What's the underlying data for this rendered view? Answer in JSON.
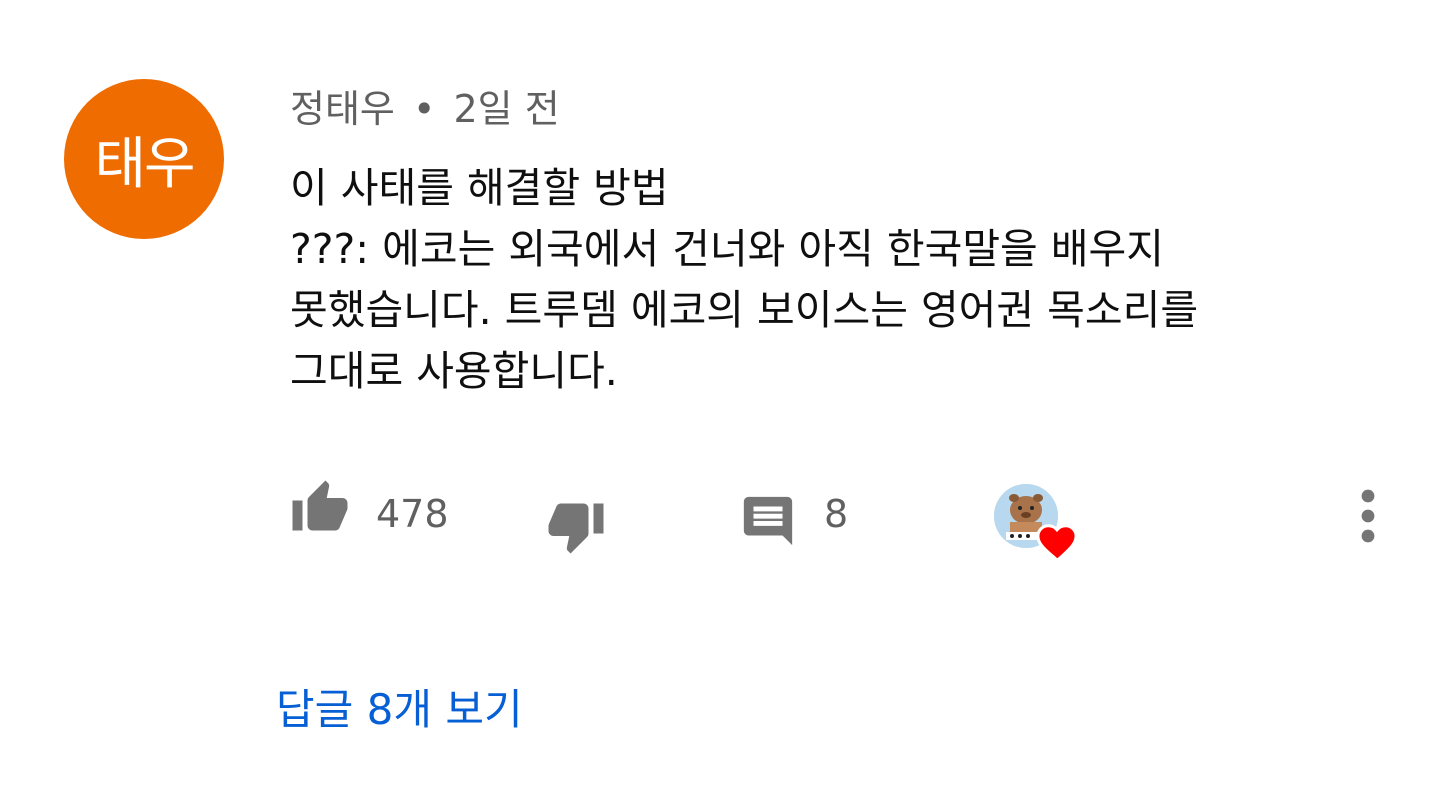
{
  "comment": {
    "avatar_text": "태우",
    "avatar_color": "#ef6c00",
    "author": "정태우",
    "separator": "•",
    "time": "2일 전",
    "text": "이 사태를 해결할 방법\n???: 에코는 외국에서 건너와 아직 한국말을 배우지\n못했습니다. 트루뎀 에코의 보이스는 영어권 목소리를\n그대로 사용합니다."
  },
  "actions": {
    "like_icon": "thumbs-up-icon",
    "like_count": "478",
    "dislike_icon": "thumbs-down-icon",
    "reply_icon": "comment-icon",
    "reply_count": "8",
    "creator_heart_icon": "heart-icon",
    "more_icon": "more-vert-icon"
  },
  "replies": {
    "label": "답글 8개 보기",
    "link_color": "#065fd4"
  }
}
